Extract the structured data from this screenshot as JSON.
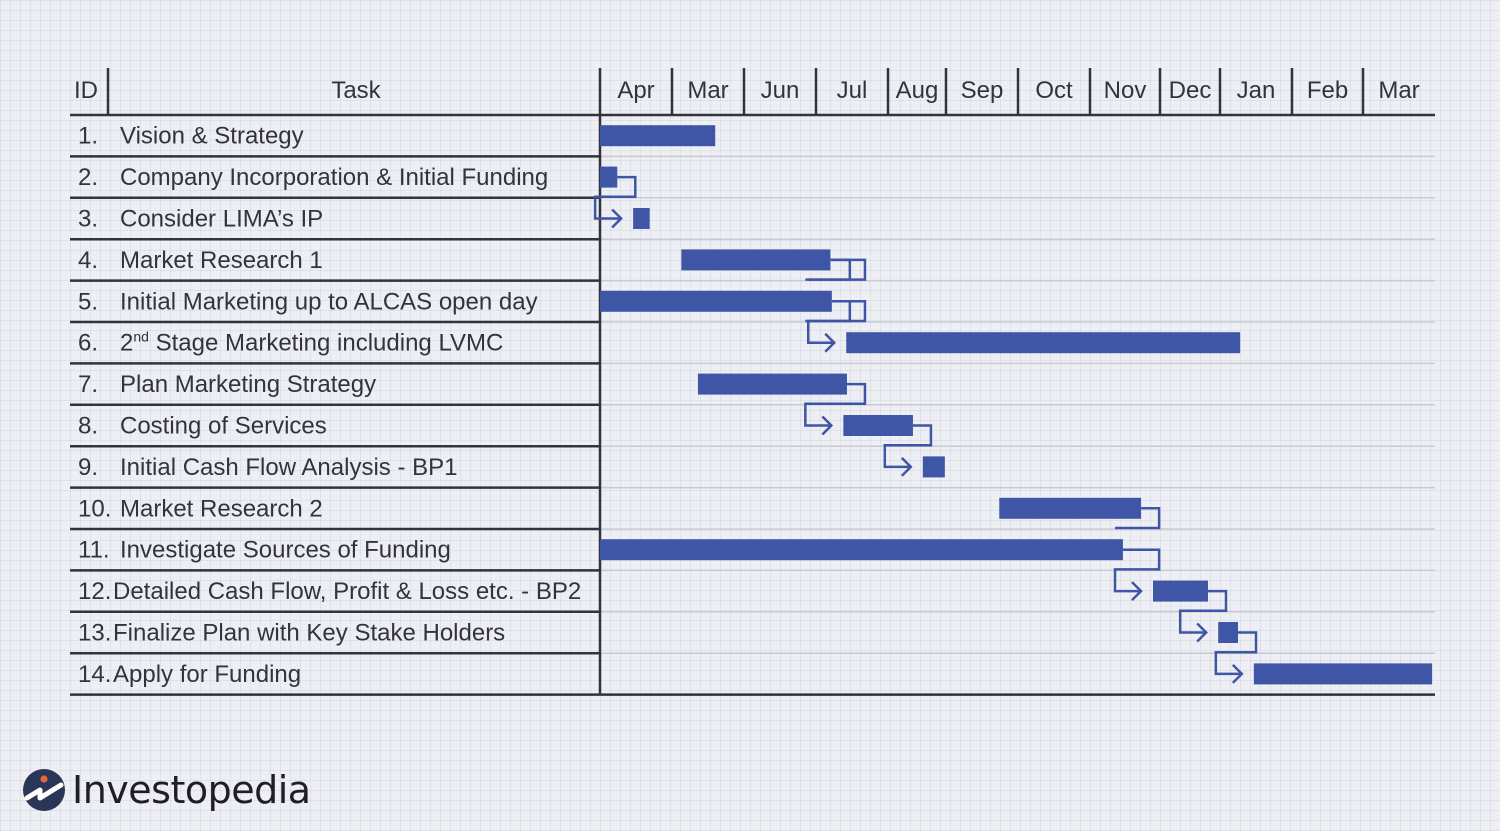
{
  "chart_data": {
    "type": "gantt",
    "title": "",
    "columns": {
      "id": "ID",
      "task": "Task"
    },
    "months": [
      "Apr",
      "Mar",
      "Jun",
      "Jul",
      "Aug",
      "Sep",
      "Oct",
      "Nov",
      "Dec",
      "Jan",
      "Feb",
      "Mar"
    ],
    "time_unit": "month index from start of first column (0) to end of last column (12)",
    "tasks": [
      {
        "id": "1.",
        "name": "Vision & Strategy",
        "start": 0.0,
        "end": 1.6
      },
      {
        "id": "2.",
        "name": "Company Incorporation & Initial Funding",
        "start": 0.0,
        "end": 0.24
      },
      {
        "id": "3.",
        "name": "Consider LIMA’s IP",
        "start": 0.46,
        "end": 0.69
      },
      {
        "id": "4.",
        "name": "Market Research 1",
        "start": 1.13,
        "end": 3.2
      },
      {
        "id": "5.",
        "name": "Initial Marketing up to ALCAS open day",
        "start": 0.0,
        "end": 3.22
      },
      {
        "id": "6.",
        "name": "2nd Stage Marketing including LVMC",
        "name_prefix": "2",
        "name_sup": "nd",
        "name_rest": " Stage Marketing including LVMC",
        "start": 3.42,
        "end": 9.28
      },
      {
        "id": "7.",
        "name": "Plan Marketing Strategy",
        "start": 1.36,
        "end": 3.43
      },
      {
        "id": "8.",
        "name": "Costing of Services",
        "start": 3.38,
        "end": 4.43
      },
      {
        "id": "9.",
        "name": "Initial Cash Flow Analysis - BP1",
        "start": 4.6,
        "end": 4.98
      },
      {
        "id": "10.",
        "name": "Market Research 2",
        "start": 5.74,
        "end": 7.73
      },
      {
        "id": "11.",
        "name": "Investigate Sources of Funding",
        "start": 0.0,
        "end": 7.47
      },
      {
        "id": "12.",
        "name": "Detailed Cash Flow, Profit & Loss etc. - BP2",
        "start": 7.9,
        "end": 8.8
      },
      {
        "id": "13.",
        "name": "Finalize Plan with Key Stake Holders",
        "start": 8.97,
        "end": 9.25
      },
      {
        "id": "14.",
        "name": "Apply for Funding",
        "start": 9.47,
        "end": 11.96
      }
    ],
    "dependencies": [
      {
        "from": [
          "2"
        ],
        "to": "3"
      },
      {
        "from": [
          "4",
          "5"
        ],
        "to": "6"
      },
      {
        "from": [
          "4",
          "5",
          "7"
        ],
        "to": "8"
      },
      {
        "from": [
          "8"
        ],
        "to": "9"
      },
      {
        "from": [
          "10",
          "11"
        ],
        "to": "12"
      },
      {
        "from": [
          "12"
        ],
        "to": "13"
      },
      {
        "from": [
          "13"
        ],
        "to": "14"
      }
    ],
    "colors": {
      "bar": "#3f55a6",
      "line": "#33333a",
      "row_line": "#c8c9d2",
      "background": "#eeeff4"
    }
  },
  "brand": {
    "name": "Investopedia",
    "logo_icon": "investopedia-logo-icon"
  }
}
